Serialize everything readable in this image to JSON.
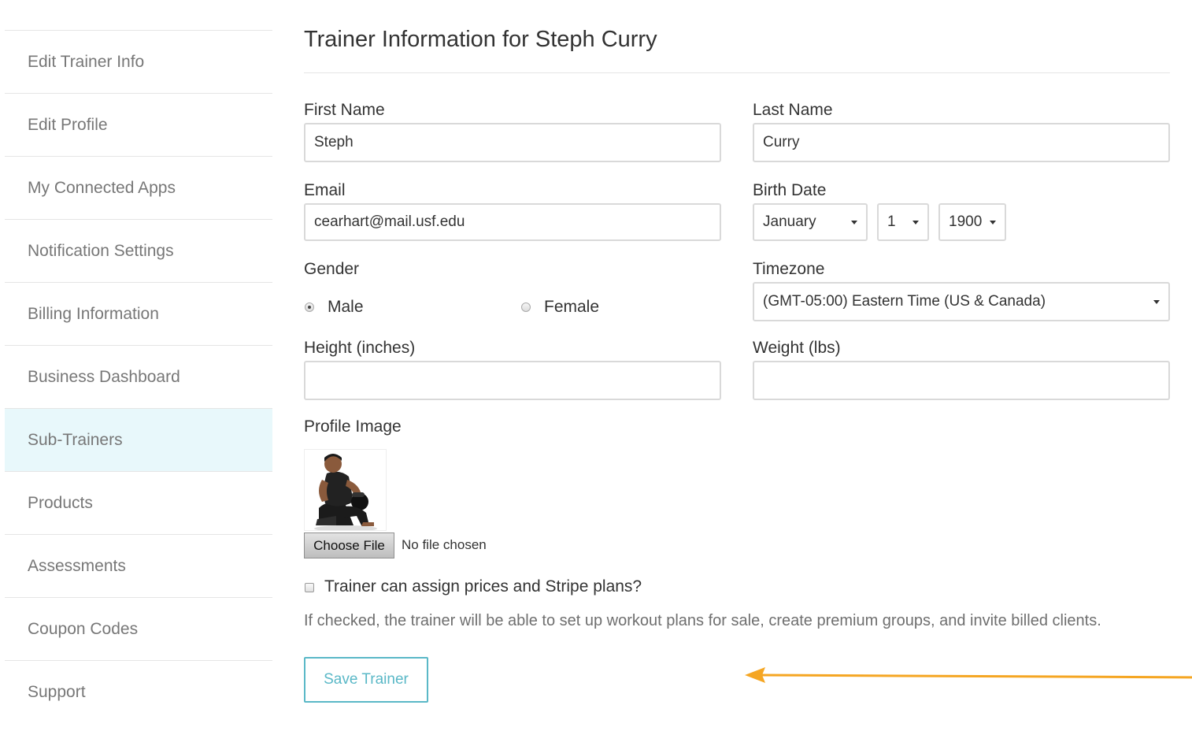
{
  "sidebar": {
    "items": [
      {
        "label": "Edit Trainer Info"
      },
      {
        "label": "Edit Profile"
      },
      {
        "label": "My Connected Apps"
      },
      {
        "label": "Notification Settings"
      },
      {
        "label": "Billing Information"
      },
      {
        "label": "Business Dashboard"
      },
      {
        "label": "Sub-Trainers"
      },
      {
        "label": "Products"
      },
      {
        "label": "Assessments"
      },
      {
        "label": "Coupon Codes"
      },
      {
        "label": "Support"
      }
    ],
    "active_item": "Sub-Trainers"
  },
  "form": {
    "title": "Trainer Information for Steph Curry",
    "first_name": {
      "label": "First Name",
      "value": "Steph"
    },
    "last_name": {
      "label": "Last Name",
      "value": "Curry"
    },
    "email": {
      "label": "Email",
      "value": "cearhart@mail.usf.edu"
    },
    "birth_date": {
      "label": "Birth Date",
      "month": "January",
      "day": "1",
      "year": "1900"
    },
    "gender": {
      "label": "Gender",
      "options": [
        "Male",
        "Female"
      ],
      "selected": "Male"
    },
    "timezone": {
      "label": "Timezone",
      "value": "(GMT-05:00) Eastern Time (US & Canada)"
    },
    "height": {
      "label": "Height (inches)",
      "value": ""
    },
    "weight": {
      "label": "Weight (lbs)",
      "value": ""
    },
    "profile_image": {
      "label": "Profile Image",
      "button_label": "Choose File",
      "status": "No file chosen"
    },
    "pricing_checkbox": {
      "label": "Trainer can assign prices and Stripe plans?",
      "checked": false,
      "help": "If checked, the trainer will be able to set up workout plans for sale, create premium groups, and invite billed clients."
    },
    "save_label": "Save Trainer"
  },
  "colors": {
    "accent": "#5ab8c7",
    "active_bg": "#e8f8fb",
    "arrow": "#f5a623"
  },
  "icons": {
    "arrow": "left-arrow-icon",
    "select_caret": "caret-down-icon"
  }
}
